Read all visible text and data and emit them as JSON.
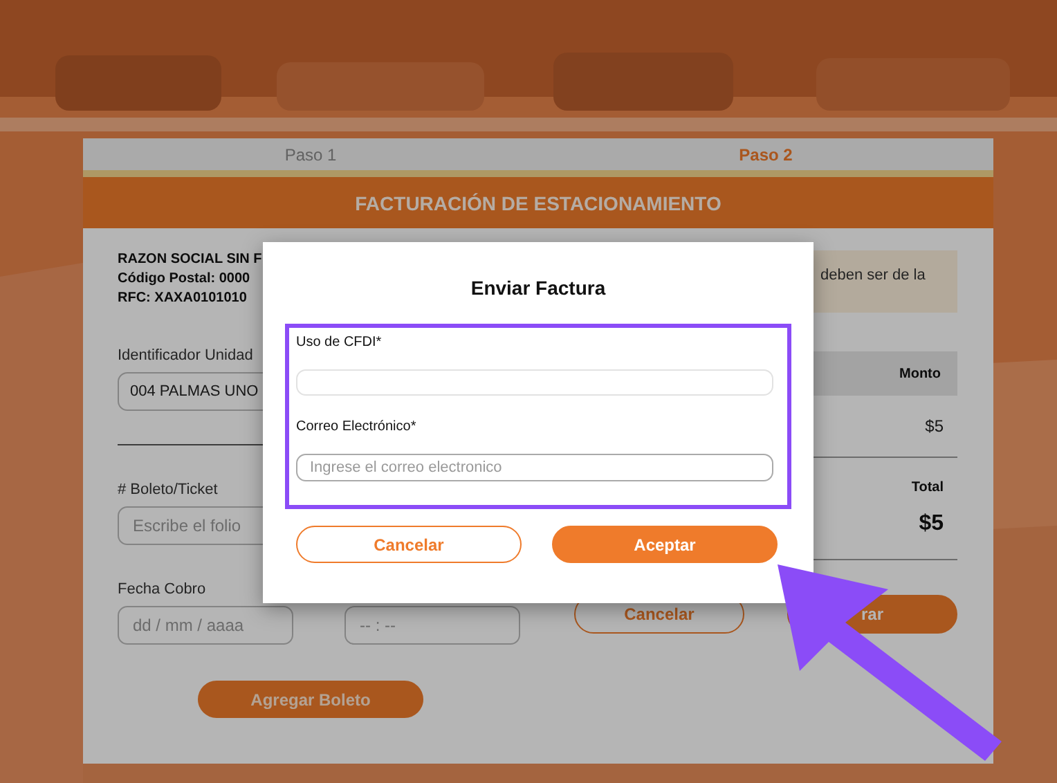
{
  "steps": [
    {
      "label": "Paso 1",
      "selected": false
    },
    {
      "label": "Paso 2",
      "selected": true
    }
  ],
  "header": {
    "title": "FACTURACIÓN DE ESTACIONAMIENTO"
  },
  "company": {
    "lines": [
      "RAZON SOCIAL SIN F",
      "Código Postal: 0000",
      "RFC: XAXA0101010"
    ]
  },
  "notice": "deben ser de la",
  "form": {
    "unit": {
      "label": "Identificador Unidad",
      "value": "004 PALMAS UNO"
    },
    "ticket": {
      "label": "# Boleto/Ticket",
      "placeholder": "Escribe el folio"
    },
    "date": {
      "label": "Fecha Cobro",
      "placeholder": "dd / mm / aaaa"
    },
    "time": {
      "placeholder": "-- : --"
    },
    "add_button": "Agregar Boleto"
  },
  "summary": {
    "amount_heading": "Monto",
    "amount": "$5",
    "total_label": "Total",
    "total": "$5"
  },
  "actions": {
    "cancel": "Cancelar",
    "confirm": "rar"
  },
  "dialog": {
    "title": "Enviar Factura",
    "fields": [
      {
        "label": "Uso de CFDI*"
      },
      {
        "label": "Correo Electrónico*",
        "placeholder": "Ingrese el correo electronico"
      }
    ],
    "buttons": [
      {
        "label": "Cancelar",
        "kind": "secondary"
      },
      {
        "label": "Aceptar",
        "kind": "primary"
      }
    ]
  }
}
